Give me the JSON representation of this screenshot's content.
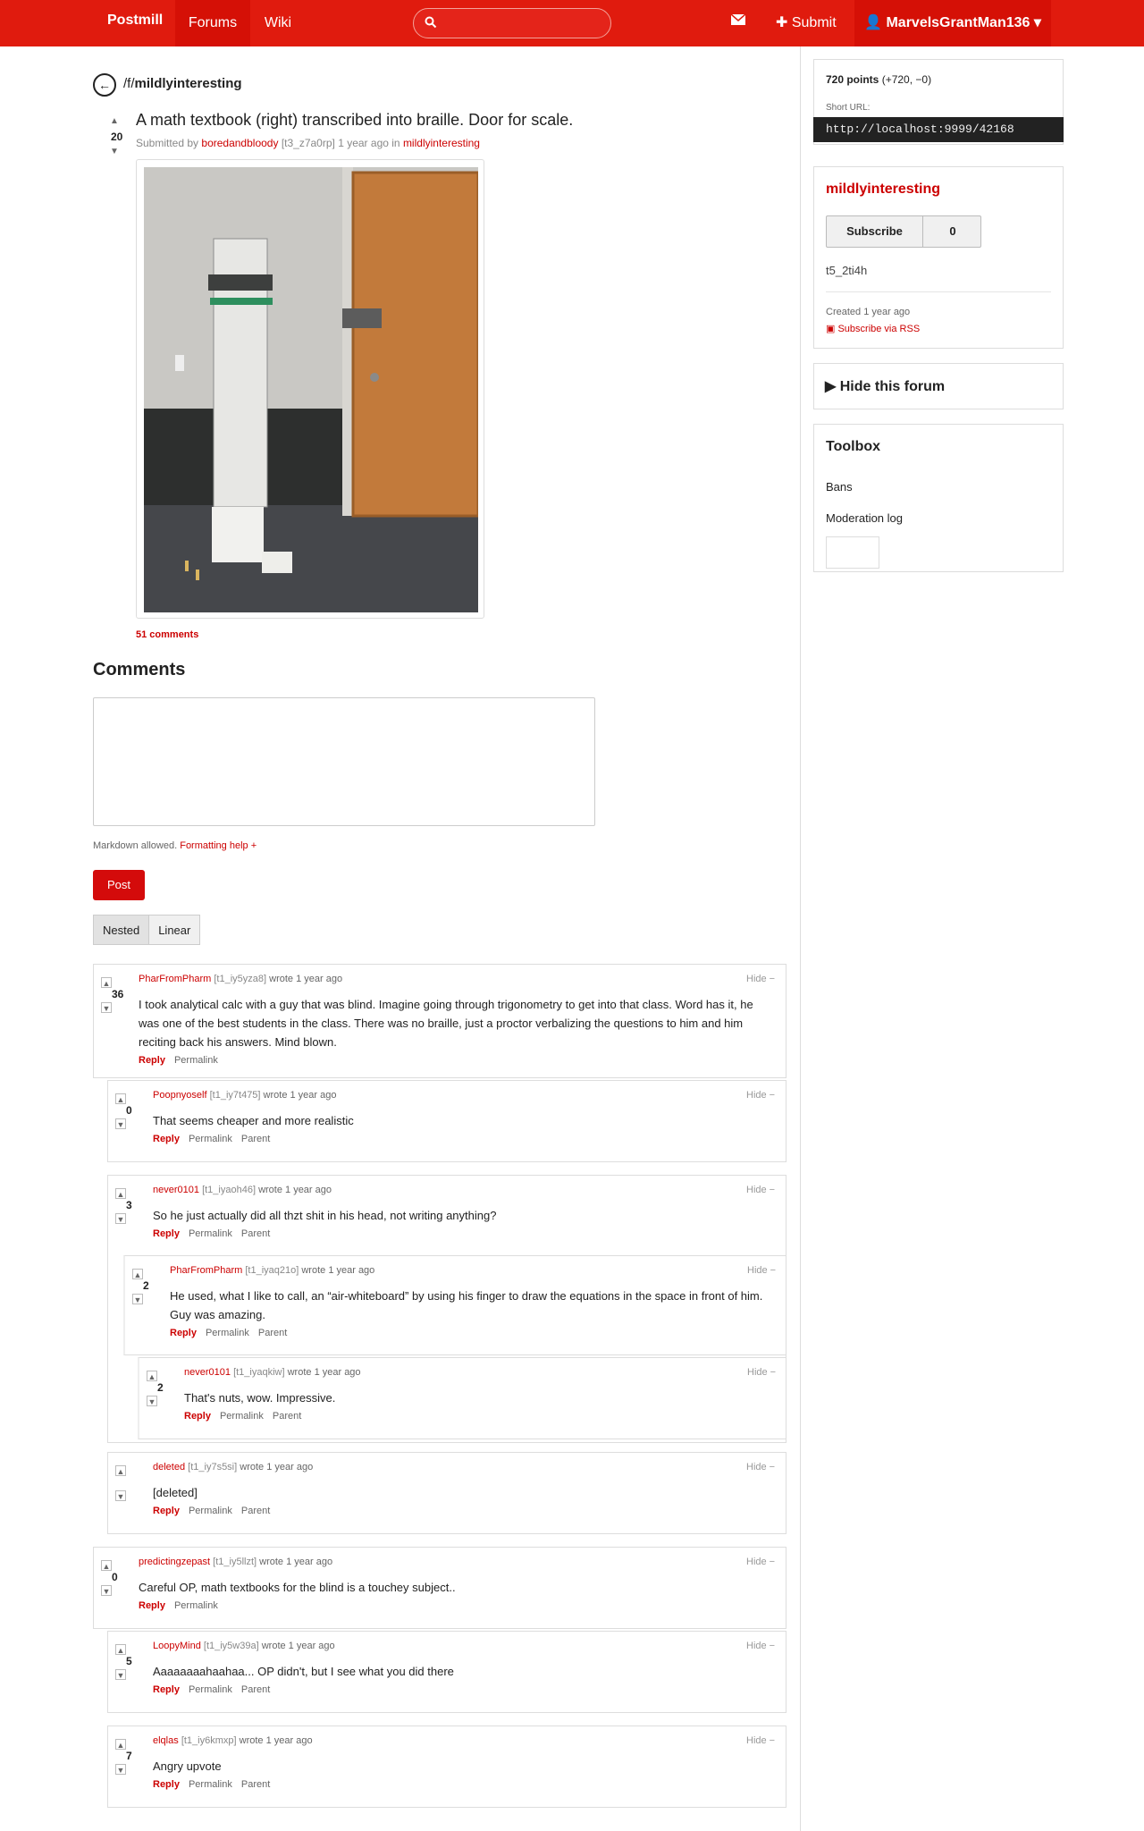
{
  "topbar": {
    "brand": "Postmill",
    "forums": "Forums",
    "wiki": "Wiki",
    "search_icon": "search-icon",
    "search_placeholder": "",
    "mail_icon": "envelope-icon",
    "submit_label": "✚ Submit",
    "user_label": "👤 MarvelsGrantMan136 ▾",
    "accent": "#e01b0e"
  },
  "breadcrumb": {
    "back_icon": "←",
    "prefix": "/f/",
    "forum": "mildlyinteresting"
  },
  "post": {
    "vote_count": "20",
    "title": "A math textbook (right) transcribed into braille. Door for scale.",
    "meta_prefix": "Submitted by",
    "author": "boredandbloody",
    "ident": "[t3_z7a0rp]",
    "time": "1 year ago in",
    "forum": "mildlyinteresting",
    "comments_link": "51 comments"
  },
  "comments_section": {
    "heading": "Comments",
    "textarea_value": "",
    "markdown_note": "Markdown allowed.",
    "formatting_help": "Formatting help +",
    "post_button": "Post",
    "nested": "Nested",
    "linear": "Linear"
  },
  "comments": [
    {
      "author": "PharFromPharm",
      "ident": "[t1_iy5yza8]",
      "wrote": "wrote 1 year ago",
      "votes": "36",
      "hide": "Hide −",
      "body": "I took analytical calc with a guy that was blind. Imagine going through trigonometry to get into that class. Word has it, he was one of the best students in the class. There was no braille, just a proctor verbalizing the questions to him and him reciting back his answers. Mind blown.",
      "reply": "Reply",
      "permalink": "Permalink",
      "parent": ""
    },
    {
      "author": "Poopnyoself",
      "ident": "[t1_iy7t475]",
      "wrote": "wrote 1 year ago",
      "votes": "0",
      "hide": "Hide −",
      "body": "That seems cheaper and more realistic",
      "reply": "Reply",
      "permalink": "Permalink",
      "parent": "Parent"
    },
    {
      "author": "never0101",
      "ident": "[t1_iyaoh46]",
      "wrote": "wrote 1 year ago",
      "votes": "3",
      "hide": "Hide −",
      "body": "So he just actually did all thzt shit in his head, not writing anything?",
      "reply": "Reply",
      "permalink": "Permalink",
      "parent": "Parent"
    },
    {
      "author": "PharFromPharm",
      "ident": "[t1_iyaq21o]",
      "wrote": "wrote 1 year ago",
      "votes": "2",
      "hide": "Hide −",
      "body": "He used, what I like to call, an “air-whiteboard” by using his finger to draw the equations in the space in front of him. Guy was amazing.",
      "reply": "Reply",
      "permalink": "Permalink",
      "parent": "Parent"
    },
    {
      "author": "never0101",
      "ident": "[t1_iyaqkiw]",
      "wrote": "wrote 1 year ago",
      "votes": "2",
      "hide": "Hide −",
      "body": "That's nuts, wow. Impressive.",
      "reply": "Reply",
      "permalink": "Permalink",
      "parent": "Parent"
    },
    {
      "author": "deleted",
      "ident": "[t1_iy7s5si]",
      "wrote": "wrote 1 year ago",
      "votes": "",
      "hide": "Hide −",
      "body": "[deleted]",
      "reply": "Reply",
      "permalink": "Permalink",
      "parent": "Parent"
    },
    {
      "author": "predictingzepast",
      "ident": "[t1_iy5llzt]",
      "wrote": "wrote 1 year ago",
      "votes": "0",
      "hide": "Hide −",
      "body": "Careful OP, math textbooks for the blind is a touchey subject..",
      "reply": "Reply",
      "permalink": "Permalink",
      "parent": ""
    },
    {
      "author": "LoopyMind",
      "ident": "[t1_iy5w39a]",
      "wrote": "wrote 1 year ago",
      "votes": "5",
      "hide": "Hide −",
      "body": "Aaaaaaaahaahaa... OP didn't, but I see what you did there",
      "reply": "Reply",
      "permalink": "Permalink",
      "parent": "Parent"
    },
    {
      "author": "elqlas",
      "ident": "[t1_iy6kmxp]",
      "wrote": "wrote 1 year ago",
      "votes": "7",
      "hide": "Hide −",
      "body": "Angry upvote",
      "reply": "Reply",
      "permalink": "Permalink",
      "parent": "Parent"
    }
  ],
  "sidebar": {
    "points": "720 points",
    "points_detail": "(+720, −0)",
    "short_url_label": "Short URL:",
    "short_url": "http://localhost:9999/42168",
    "forum_name": "mildlyinteresting",
    "subscribe": "Subscribe",
    "subscriber_count": "0",
    "forum_id": "t5_2ti4h",
    "created": "Created 1 year ago",
    "rss": "Subscribe via RSS",
    "hide_forum": "▶ Hide this forum",
    "toolbox_title": "Toolbox",
    "bans": "Bans",
    "modlog": "Moderation log"
  }
}
